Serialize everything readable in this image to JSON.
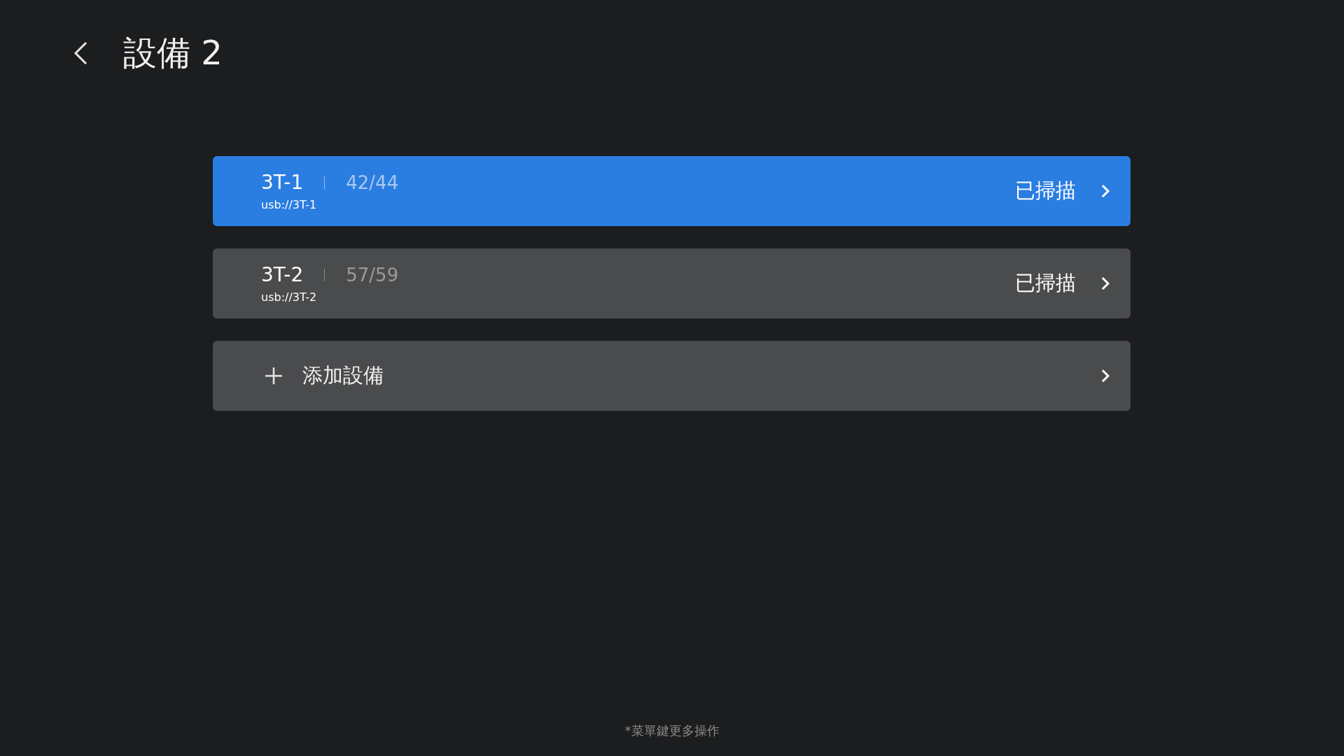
{
  "header": {
    "title": "設備 2"
  },
  "devices": [
    {
      "name": "3T-1",
      "count": "42/44",
      "uri": "usb://3T-1",
      "status": "已掃描",
      "selected": true
    },
    {
      "name": "3T-2",
      "count": "57/59",
      "uri": "usb://3T-2",
      "status": "已掃描",
      "selected": false
    }
  ],
  "add_item": {
    "label": "添加設備",
    "selected": false
  },
  "footer": {
    "hint": "*菜單鍵更多操作"
  }
}
